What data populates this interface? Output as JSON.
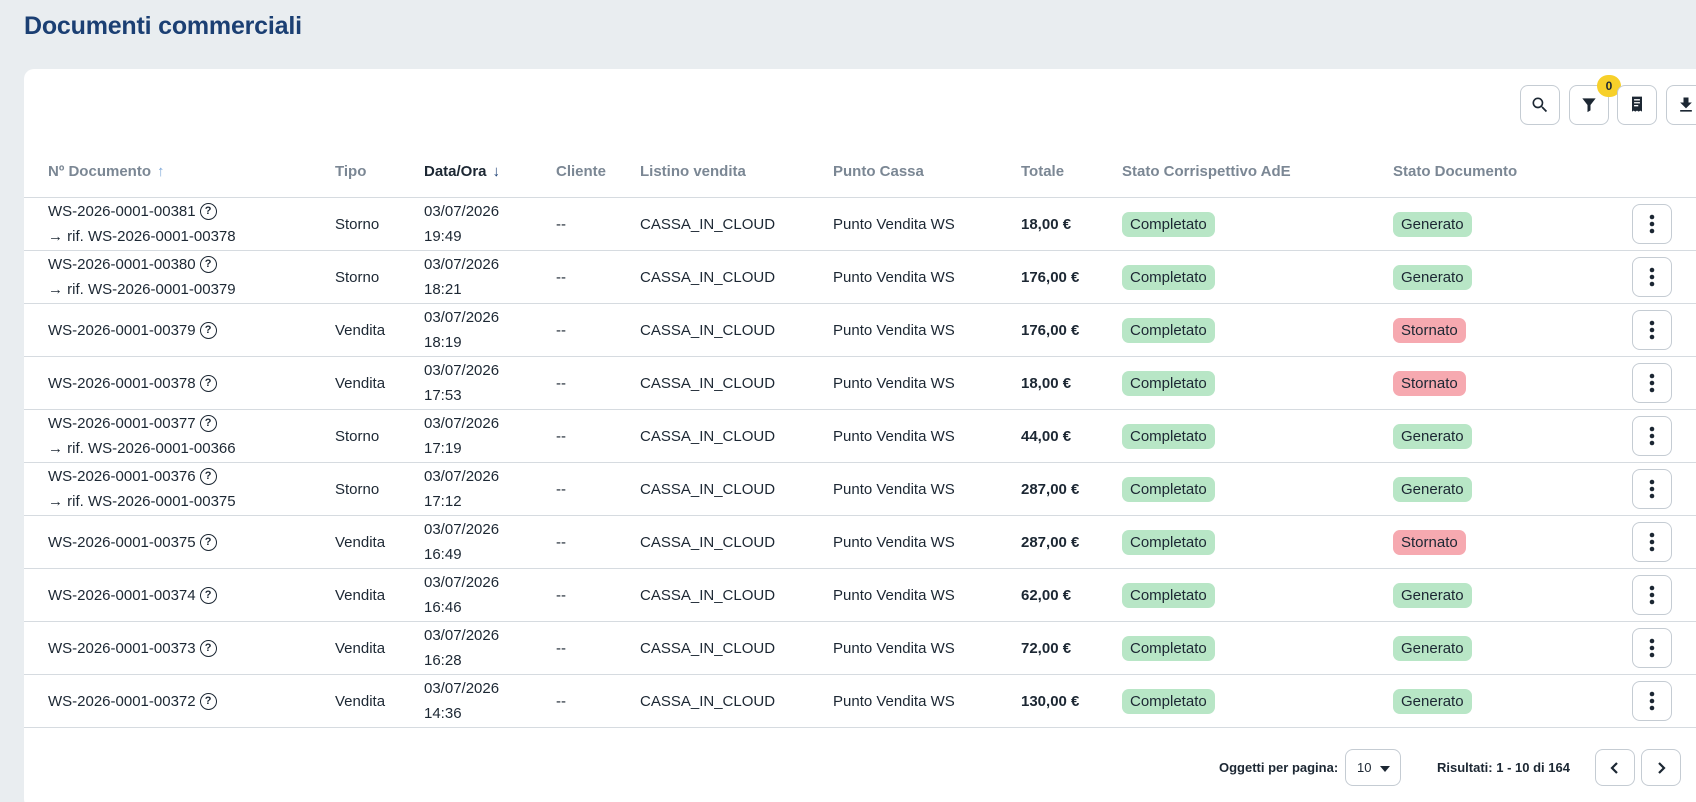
{
  "page": {
    "title": "Documenti commerciali"
  },
  "toolbar": {
    "search_icon": "search-icon",
    "filter_icon": "filter-icon",
    "filter_count": "0",
    "receipt_icon": "receipt-icon",
    "download_icon": "download-icon"
  },
  "table": {
    "headers": {
      "documento": "Nº Documento",
      "tipo": "Tipo",
      "data": "Data/Ora",
      "cliente": "Cliente",
      "listino": "Listino vendita",
      "punto": "Punto Cassa",
      "totale": "Totale",
      "stato_ade": "Stato Corrispettivo AdE",
      "stato_doc": "Stato Documento"
    },
    "sort_asc_glyph": "↑",
    "sort_desc_glyph": "↓",
    "help_glyph": "?",
    "rows": [
      {
        "doc": "WS-2026-0001-00381",
        "ref": "→ rif. WS-2026-0001-00378",
        "tipo": "Storno",
        "date": "03/07/2026",
        "time": "19:49",
        "cliente": "--",
        "listino": "CASSA_IN_CLOUD",
        "punto": "Punto Vendita WS",
        "totale": "18,00 €",
        "stato_ade": "Completato",
        "stato_doc": "Generato",
        "stato_doc_color": "green"
      },
      {
        "doc": "WS-2026-0001-00380",
        "ref": "→ rif. WS-2026-0001-00379",
        "tipo": "Storno",
        "date": "03/07/2026",
        "time": "18:21",
        "cliente": "--",
        "listino": "CASSA_IN_CLOUD",
        "punto": "Punto Vendita WS",
        "totale": "176,00 €",
        "stato_ade": "Completato",
        "stato_doc": "Generato",
        "stato_doc_color": "green"
      },
      {
        "doc": "WS-2026-0001-00379",
        "ref": "",
        "tipo": "Vendita",
        "date": "03/07/2026",
        "time": "18:19",
        "cliente": "--",
        "listino": "CASSA_IN_CLOUD",
        "punto": "Punto Vendita WS",
        "totale": "176,00 €",
        "stato_ade": "Completato",
        "stato_doc": "Stornato",
        "stato_doc_color": "red"
      },
      {
        "doc": "WS-2026-0001-00378",
        "ref": "",
        "tipo": "Vendita",
        "date": "03/07/2026",
        "time": "17:53",
        "cliente": "--",
        "listino": "CASSA_IN_CLOUD",
        "punto": "Punto Vendita WS",
        "totale": "18,00 €",
        "stato_ade": "Completato",
        "stato_doc": "Stornato",
        "stato_doc_color": "red"
      },
      {
        "doc": "WS-2026-0001-00377",
        "ref": "→ rif. WS-2026-0001-00366",
        "tipo": "Storno",
        "date": "03/07/2026",
        "time": "17:19",
        "cliente": "--",
        "listino": "CASSA_IN_CLOUD",
        "punto": "Punto Vendita WS",
        "totale": "44,00 €",
        "stato_ade": "Completato",
        "stato_doc": "Generato",
        "stato_doc_color": "green"
      },
      {
        "doc": "WS-2026-0001-00376",
        "ref": "→ rif. WS-2026-0001-00375",
        "tipo": "Storno",
        "date": "03/07/2026",
        "time": "17:12",
        "cliente": "--",
        "listino": "CASSA_IN_CLOUD",
        "punto": "Punto Vendita WS",
        "totale": "287,00 €",
        "stato_ade": "Completato",
        "stato_doc": "Generato",
        "stato_doc_color": "green"
      },
      {
        "doc": "WS-2026-0001-00375",
        "ref": "",
        "tipo": "Vendita",
        "date": "03/07/2026",
        "time": "16:49",
        "cliente": "--",
        "listino": "CASSA_IN_CLOUD",
        "punto": "Punto Vendita WS",
        "totale": "287,00 €",
        "stato_ade": "Completato",
        "stato_doc": "Stornato",
        "stato_doc_color": "red"
      },
      {
        "doc": "WS-2026-0001-00374",
        "ref": "",
        "tipo": "Vendita",
        "date": "03/07/2026",
        "time": "16:46",
        "cliente": "--",
        "listino": "CASSA_IN_CLOUD",
        "punto": "Punto Vendita WS",
        "totale": "62,00 €",
        "stato_ade": "Completato",
        "stato_doc": "Generato",
        "stato_doc_color": "green"
      },
      {
        "doc": "WS-2026-0001-00373",
        "ref": "",
        "tipo": "Vendita",
        "date": "03/07/2026",
        "time": "16:28",
        "cliente": "--",
        "listino": "CASSA_IN_CLOUD",
        "punto": "Punto Vendita WS",
        "totale": "72,00 €",
        "stato_ade": "Completato",
        "stato_doc": "Generato",
        "stato_doc_color": "green"
      },
      {
        "doc": "WS-2026-0001-00372",
        "ref": "",
        "tipo": "Vendita",
        "date": "03/07/2026",
        "time": "14:36",
        "cliente": "--",
        "listino": "CASSA_IN_CLOUD",
        "punto": "Punto Vendita WS",
        "totale": "130,00 €",
        "stato_ade": "Completato",
        "stato_doc": "Generato",
        "stato_doc_color": "green"
      }
    ]
  },
  "pagination": {
    "per_page_label": "Oggetti per pagina:",
    "per_page_value": "10",
    "results": "Risultati: 1 - 10 di 164"
  }
}
